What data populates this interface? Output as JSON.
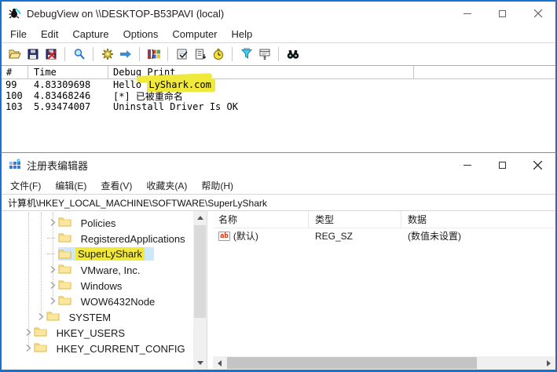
{
  "colors": {
    "accent_border": "#1473d2",
    "highlight_yellow": "#f0e83a",
    "selection_blue": "#cce8ff"
  },
  "debugview": {
    "title": "DebugView on \\\\DESKTOP-B53PAVI (local)",
    "menu": [
      "File",
      "Edit",
      "Capture",
      "Options",
      "Computer",
      "Help"
    ],
    "toolbar_icons": [
      "open",
      "save",
      "save-log",
      "capture-win32",
      "capture-kernel",
      "passthrough",
      "capture-global-win32",
      "capture-events",
      "autoscroll",
      "clock",
      "filter-highlight",
      "history-depth",
      "find"
    ],
    "list": {
      "columns": [
        "#",
        "Time",
        "Debug Print"
      ],
      "rows": [
        {
          "num": "99",
          "time": "4.83309698",
          "text": "Hello ",
          "highlight": "LyShark.com"
        },
        {
          "num": "100",
          "time": "4.83468246",
          "text": "[*] 已被重命名",
          "highlight": ""
        },
        {
          "num": "103",
          "time": "5.93474007",
          "text": "Uninstall Driver Is OK",
          "highlight": ""
        }
      ]
    }
  },
  "regedit": {
    "title": "注册表编辑器",
    "menu": [
      "文件(F)",
      "编辑(E)",
      "查看(V)",
      "收藏夹(A)",
      "帮助(H)"
    ],
    "address": "计算机\\HKEY_LOCAL_MACHINE\\SOFTWARE\\SuperLyShark",
    "tree": [
      {
        "label": "Policies",
        "depth": 3,
        "arrow": true,
        "selected": false
      },
      {
        "label": "RegisteredApplications",
        "depth": 3,
        "arrow": false,
        "selected": false
      },
      {
        "label": "SuperLyShark",
        "depth": 3,
        "arrow": false,
        "selected": true
      },
      {
        "label": "VMware, Inc.",
        "depth": 3,
        "arrow": true,
        "selected": false
      },
      {
        "label": "Windows",
        "depth": 3,
        "arrow": true,
        "selected": false
      },
      {
        "label": "WOW6432Node",
        "depth": 3,
        "arrow": true,
        "selected": false
      },
      {
        "label": "SYSTEM",
        "depth": 2,
        "arrow": true,
        "selected": false
      },
      {
        "label": "HKEY_USERS",
        "depth": 1,
        "arrow": true,
        "selected": false
      },
      {
        "label": "HKEY_CURRENT_CONFIG",
        "depth": 1,
        "arrow": true,
        "selected": false
      }
    ],
    "values": {
      "columns": [
        "名称",
        "类型",
        "数据"
      ],
      "rows": [
        {
          "name": "(默认)",
          "type": "REG_SZ",
          "data": "(数值未设置)"
        }
      ]
    }
  }
}
